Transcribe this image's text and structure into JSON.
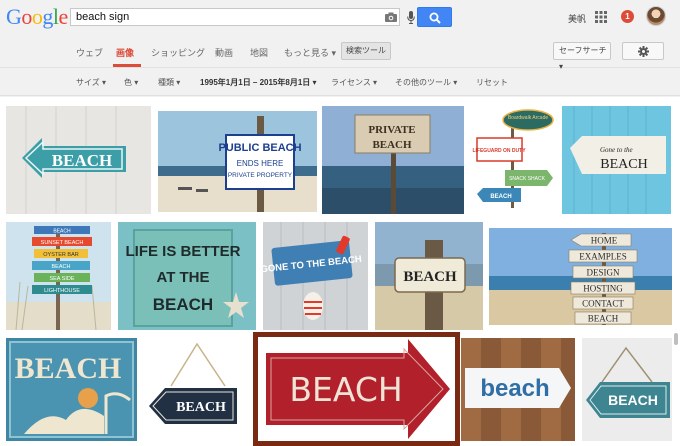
{
  "header": {
    "logo_letters": [
      "G",
      "o",
      "o",
      "g",
      "l",
      "e"
    ],
    "logo_colors": [
      "#4285f4",
      "#ea4335",
      "#fbbc05",
      "#4285f4",
      "#34a853",
      "#ea4335"
    ],
    "search_value": "beach sign",
    "user_name": "美帆",
    "notification_count": "1"
  },
  "tabs": {
    "items": [
      "ウェブ",
      "画像",
      "ショッピング",
      "動画",
      "地図",
      "もっと見る ▾",
      "検索ツール"
    ],
    "active": "画像",
    "safe_search": "セーフサーチ ▾"
  },
  "tools": {
    "size": "サイズ ▾",
    "color": "色 ▾",
    "type": "種類 ▾",
    "date_range": "1995年1月1日 – 2015年8月1日 ▾",
    "license": "ライセンス ▾",
    "other": "その他のツール ▾",
    "reset": "リセット"
  },
  "images": {
    "r1": [
      "BEACH",
      "PUBLIC BEACH",
      "ENDS HERE",
      "PRIVATE PROPERTY",
      "PRIVATE",
      "BEACH",
      "Boardwalk Arcade",
      "LIFEGUARD ON DUTY",
      "SNACK SHACK",
      "BEACH",
      "Gone to the",
      "BEACH"
    ],
    "r2": [
      "BEACH",
      "SUNSET BEACH",
      "OYSTER BAR",
      "BEACH",
      "SEA SIDE",
      "LIGHTHOUSE",
      "LIFE IS BETTER",
      "AT THE",
      "BEACH",
      "GONE TO THE BEACH",
      "BEACH",
      "HOME",
      "EXAMPLES",
      "DESIGN",
      "HOSTING",
      "CONTACT",
      "BEACH"
    ],
    "r3": [
      "BEACH",
      "BEACH",
      "BEACH",
      "beach",
      "BEACH"
    ]
  },
  "colors": {
    "accent_red": "#dd4b39",
    "search_blue": "#4285f4",
    "selected_frame": "#7a2a12"
  }
}
